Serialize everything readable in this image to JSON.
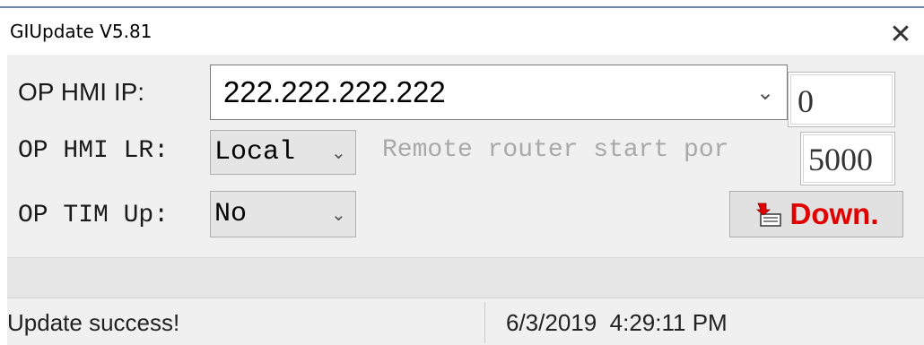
{
  "window": {
    "title": "GIUpdate V5.81",
    "close_symbol": "✕"
  },
  "form": {
    "hmi_ip": {
      "label": "OP HMI IP:",
      "value": "222.222.222.222",
      "side_value": "0"
    },
    "hmi_lr": {
      "label": "OP HMI LR:",
      "selected": "Local",
      "remote_label": "Remote router start por",
      "port_value": "5000"
    },
    "tim_up": {
      "label": "OP TIM Up:",
      "selected": "No"
    },
    "download_button": {
      "label": "Down.",
      "icon": "download-device-icon"
    }
  },
  "status": {
    "message": "Update success!",
    "timestamp": "6/3/2019  4:29:11 PM"
  },
  "colors": {
    "accent_red": "#e00000",
    "title_border": "#6f87b3",
    "disabled_text": "#a9a9a9"
  }
}
